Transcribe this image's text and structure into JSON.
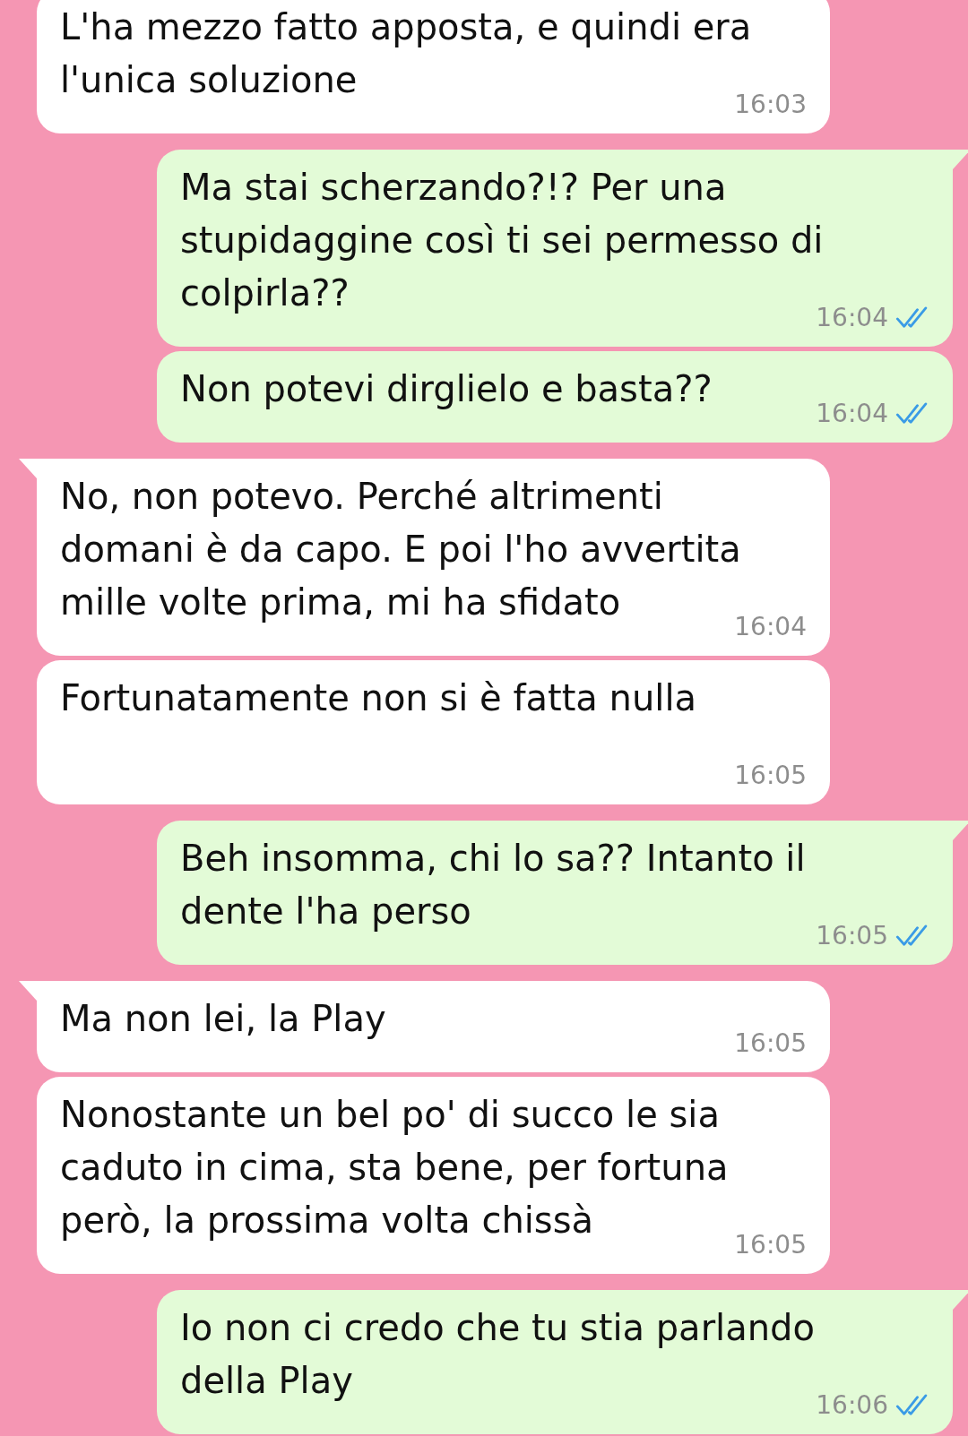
{
  "messages": [
    {
      "kind": "in",
      "tail": false,
      "text": "L'ha mezzo fatto apposta, e quindi era l'unica soluzione",
      "time": "16:03"
    },
    {
      "kind": "out",
      "tail": true,
      "text": "Ma stai scherzando?!? Per una stupidaggine così ti sei permesso di colpirla??",
      "time": "16:04",
      "read": true
    },
    {
      "kind": "out",
      "tail": false,
      "text": "Non potevi dirglielo e basta??",
      "time": "16:04",
      "read": true
    },
    {
      "kind": "in",
      "tail": true,
      "text": "No, non potevo. Perché altrimenti domani è da capo. E poi l'ho avvertita mille volte prima, mi ha sfidato",
      "time": "16:04"
    },
    {
      "kind": "in",
      "tail": false,
      "text": "Fortunatamente non si è fatta nulla",
      "time": "16:05"
    },
    {
      "kind": "out",
      "tail": true,
      "text": "Beh insomma, chi lo sa?? Intanto il dente l'ha perso",
      "time": "16:05",
      "read": true
    },
    {
      "kind": "in",
      "tail": true,
      "text": "Ma non lei, la Play",
      "time": "16:05"
    },
    {
      "kind": "in",
      "tail": false,
      "text": "Nonostante un bel po' di succo le sia caduto in cima, sta bene, per fortuna però, la prossima volta chissà",
      "time": "16:05"
    },
    {
      "kind": "out",
      "tail": true,
      "text": "Io non ci credo che tu stia parlando della Play",
      "time": "16:06",
      "read": true
    }
  ]
}
